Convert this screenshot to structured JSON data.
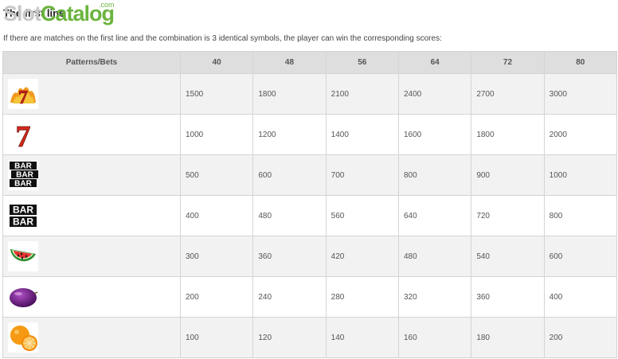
{
  "heading": "The first line",
  "logo": {
    "part1": "Slot",
    "part2": "Catalog",
    "suffix": ".com"
  },
  "intro": "If there are matches on the first line and the combination is 3 identical symbols, the player can win the corresponding scores:",
  "table": {
    "header": [
      "Patterns/Bets",
      "40",
      "48",
      "56",
      "64",
      "72",
      "80"
    ],
    "rows": [
      {
        "icon": "fire-seven-icon",
        "values": [
          "1500",
          "1800",
          "2100",
          "2400",
          "2700",
          "3000"
        ]
      },
      {
        "icon": "red-seven-icon",
        "values": [
          "1000",
          "1200",
          "1400",
          "1600",
          "1800",
          "2000"
        ]
      },
      {
        "icon": "triple-bar-icon",
        "values": [
          "500",
          "600",
          "700",
          "800",
          "900",
          "1000"
        ]
      },
      {
        "icon": "double-bar-icon",
        "values": [
          "400",
          "480",
          "560",
          "640",
          "720",
          "800"
        ]
      },
      {
        "icon": "watermelon-icon",
        "values": [
          "300",
          "360",
          "420",
          "480",
          "540",
          "600"
        ]
      },
      {
        "icon": "plum-icon",
        "values": [
          "200",
          "240",
          "280",
          "320",
          "360",
          "400"
        ]
      },
      {
        "icon": "orange-icon",
        "values": [
          "100",
          "120",
          "140",
          "160",
          "180",
          "200"
        ]
      }
    ]
  },
  "bar_text": "BAR",
  "seven_text": "7"
}
